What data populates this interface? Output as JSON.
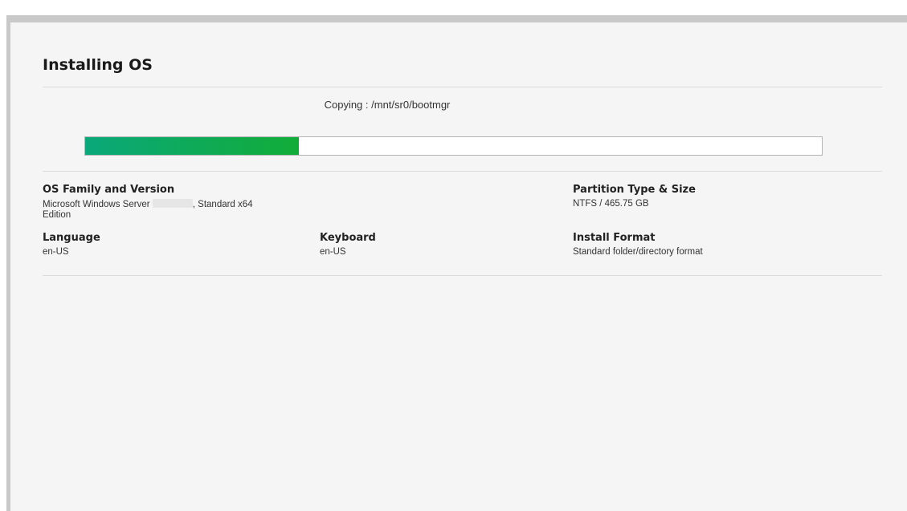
{
  "title": "Installing OS",
  "progress": {
    "status_text": "Copying : /mnt/sr0/bootmgr",
    "fraction": 0.29
  },
  "details": {
    "os_family": {
      "label": "OS Family and Version",
      "value_prefix": "Microsoft Windows Server",
      "value_suffix": ", Standard x64",
      "value_line2": "Edition"
    },
    "partition": {
      "label": "Partition Type & Size",
      "value": "NTFS / 465.75 GB"
    },
    "language": {
      "label": "Language",
      "value": "en-US"
    },
    "keyboard": {
      "label": "Keyboard",
      "value": "en-US"
    },
    "install_format": {
      "label": "Install Format",
      "value": "Standard folder/directory format"
    }
  },
  "colors": {
    "progress_start": "#0aa87a",
    "progress_end": "#12ac38"
  }
}
